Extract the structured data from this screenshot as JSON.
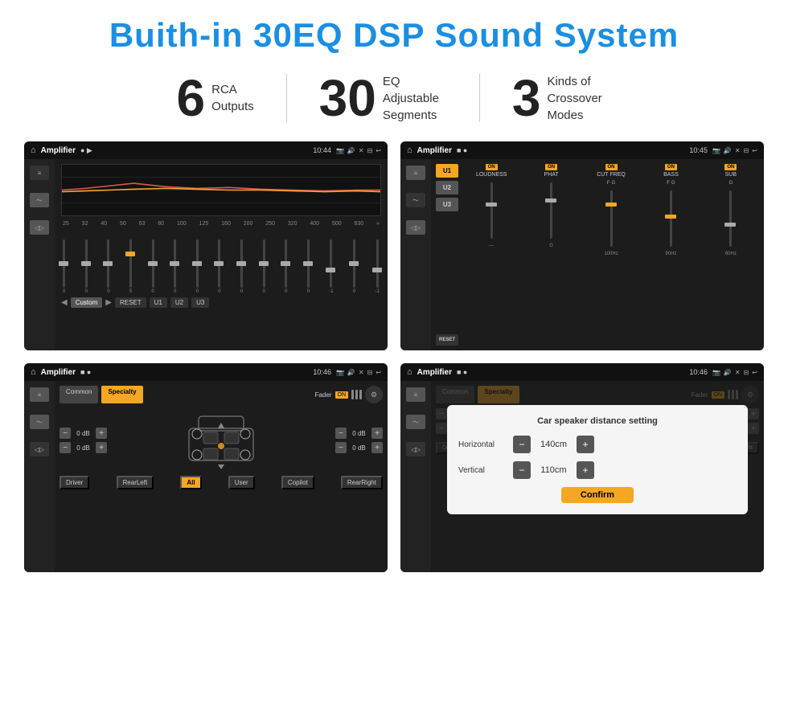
{
  "title": "Buith-in 30EQ DSP Sound System",
  "stats": [
    {
      "number": "6",
      "label": "RCA\nOutputs"
    },
    {
      "number": "30",
      "label": "EQ Adjustable\nSegments"
    },
    {
      "number": "3",
      "label": "Kinds of\nCrossover Modes"
    }
  ],
  "screens": [
    {
      "id": "eq-screen",
      "topbar": {
        "title": "Amplifier",
        "time": "10:44"
      },
      "type": "eq",
      "freqs": [
        "25",
        "32",
        "40",
        "50",
        "63",
        "80",
        "100",
        "125",
        "160",
        "200",
        "250",
        "320",
        "400",
        "500",
        "630"
      ],
      "values": [
        "0",
        "0",
        "0",
        "5",
        "0",
        "0",
        "0",
        "0",
        "0",
        "0",
        "0",
        "0",
        "-1",
        "0",
        "-1"
      ],
      "buttons": [
        "Custom",
        "RESET",
        "U1",
        "U2",
        "U3"
      ]
    },
    {
      "id": "crossover-screen",
      "topbar": {
        "title": "Amplifier",
        "time": "10:45"
      },
      "type": "crossover",
      "presets": [
        "U1",
        "U2",
        "U3"
      ],
      "controls": [
        "LOUDNESS",
        "PHAT",
        "CUT FREQ",
        "BASS",
        "SUB"
      ]
    },
    {
      "id": "zones-screen",
      "topbar": {
        "title": "Amplifier",
        "time": "10:46"
      },
      "type": "zones",
      "tabs": [
        "Common",
        "Specialty"
      ],
      "fader_label": "Fader",
      "fader_on": "ON",
      "zones_left": [
        "0 dB",
        "0 dB"
      ],
      "zones_right": [
        "0 dB",
        "0 dB"
      ],
      "bottom_buttons": [
        "Driver",
        "RearLeft",
        "All",
        "User",
        "Copilot",
        "RearRight"
      ]
    },
    {
      "id": "distance-screen",
      "topbar": {
        "title": "Amplifier",
        "time": "10:46"
      },
      "type": "distance",
      "tabs": [
        "Common",
        "Specialty"
      ],
      "dialog": {
        "title": "Car speaker distance setting",
        "horizontal_label": "Horizontal",
        "horizontal_value": "140cm",
        "vertical_label": "Vertical",
        "vertical_value": "110cm",
        "confirm_label": "Confirm"
      }
    }
  ]
}
